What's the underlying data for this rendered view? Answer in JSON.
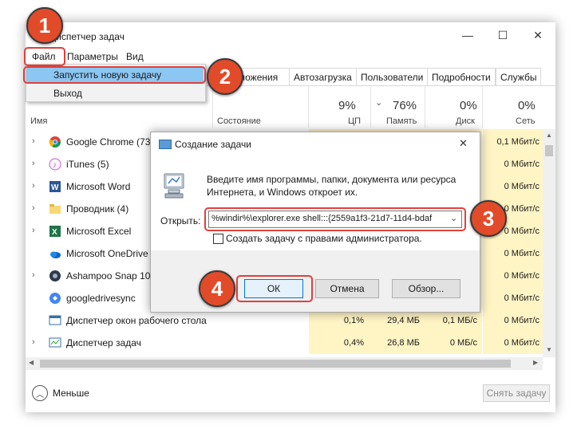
{
  "window": {
    "title": "Диспетчер задач",
    "minimize": "—",
    "maximize": "☐",
    "close": "✕"
  },
  "menu": [
    "Файл",
    "Параметры",
    "Вид"
  ],
  "dropdown": {
    "run_new_task": "Запустить новую задачу",
    "exit": "Выход"
  },
  "tabs": [
    "ложения",
    "Автозагрузка",
    "Пользователи",
    "Подробности",
    "Службы"
  ],
  "columns": {
    "name": "Имя",
    "status": "Состояние",
    "cpu": {
      "pct": "9%",
      "label": "ЦП"
    },
    "memory": {
      "pct": "76%",
      "label": "Память"
    },
    "disk": {
      "pct": "0%",
      "label": "Диск"
    },
    "network": {
      "pct": "0%",
      "label": "Сеть"
    }
  },
  "processes": [
    {
      "name": "Google Chrome (73)",
      "expand": true,
      "icon": "chrome-icon",
      "network": "0,1 Мбит/с"
    },
    {
      "name": "iTunes (5)",
      "expand": true,
      "icon": "itunes-icon",
      "network": "0 Мбит/с"
    },
    {
      "name": "Microsoft Word",
      "expand": true,
      "icon": "word-icon",
      "network": "0 Мбит/с"
    },
    {
      "name": "Проводник (4)",
      "expand": true,
      "icon": "explorer-icon",
      "network": "0 Мбит/с"
    },
    {
      "name": "Microsoft Excel",
      "expand": true,
      "icon": "excel-icon",
      "network": "0 Мбит/с"
    },
    {
      "name": "Microsoft OneDrive",
      "expand": false,
      "icon": "onedrive-icon",
      "network": "0 Мбит/с"
    },
    {
      "name": "Ashampoo Snap 10",
      "expand": true,
      "icon": "ashampoo-icon",
      "network": "0 Мбит/с"
    },
    {
      "name": "googledrivesync",
      "expand": false,
      "icon": "gdrive-icon",
      "network": "0 Мбит/с"
    },
    {
      "name": "Диспетчер окон рабочего стола",
      "expand": false,
      "icon": "dwm-icon",
      "cpu": "0,1%",
      "memory": "29,4 МБ",
      "disk": "0,1 МБ/с",
      "network": "0 Мбит/с"
    },
    {
      "name": "Диспетчер задач",
      "expand": true,
      "icon": "taskmgr-icon",
      "cpu": "0,4%",
      "memory": "26,8 МБ",
      "disk": "0 МБ/с",
      "network": "0 Мбит/с"
    }
  ],
  "footer": {
    "less": "Меньше",
    "end_task": "Снять задачу"
  },
  "dialog": {
    "title": "Создание задачи",
    "close": "✕",
    "description": "Введите имя программы, папки, документа или ресурса Интернета, и Windows откроет их.",
    "open_label": "Открыть:",
    "open_value": "%windir%\\explorer.exe shell:::{2559a1f3-21d7-11d4-bdaf",
    "admin_checkbox": "Создать задачу с правами администратора.",
    "ok": "ОК",
    "cancel": "Отмена",
    "browse": "Обзор..."
  },
  "badges": [
    "1",
    "2",
    "3",
    "4"
  ],
  "colors": {
    "badge": "#e14b2a",
    "highlight": "#e0403a",
    "selection": "#8cc6f2",
    "heat": "#fff4c4"
  }
}
